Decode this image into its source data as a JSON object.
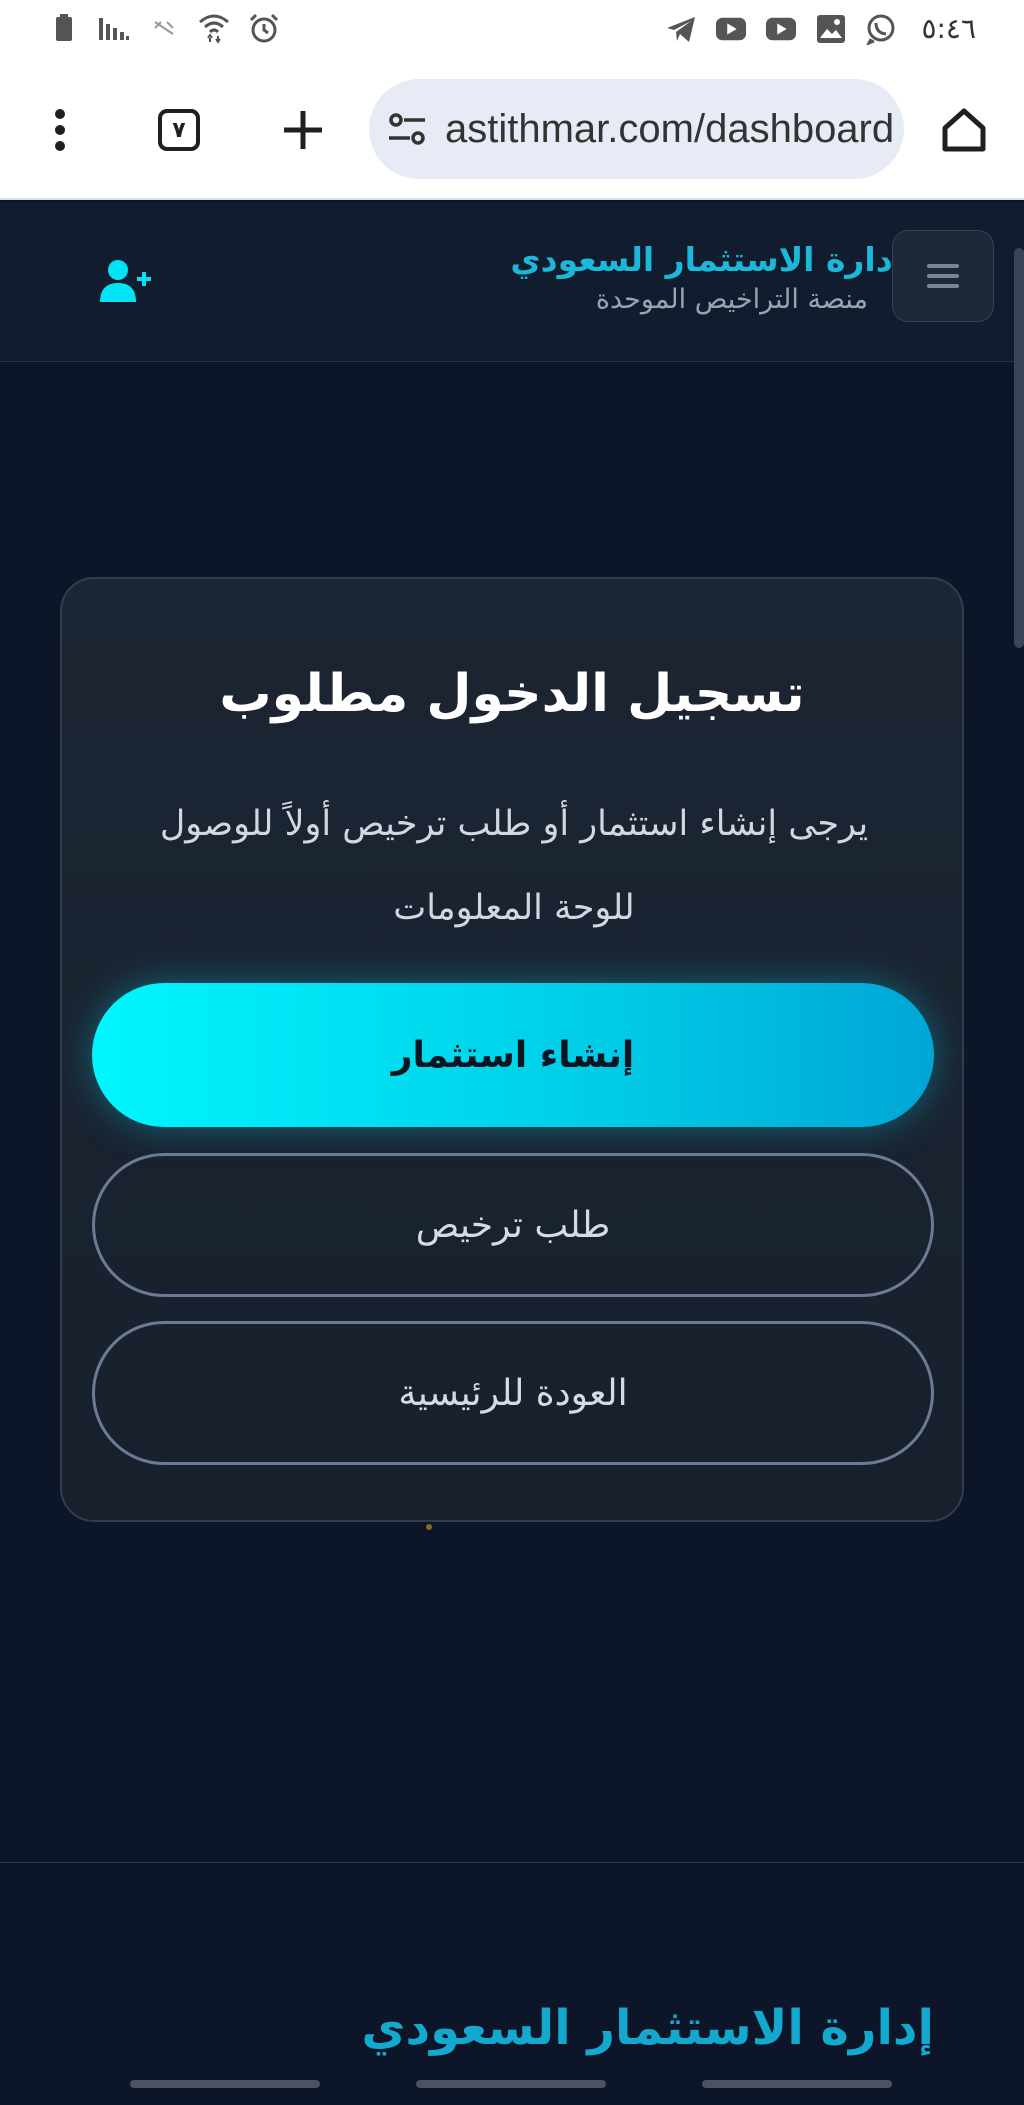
{
  "status_bar": {
    "time": "٥:٤٦",
    "left_icons": [
      "battery-icon",
      "signal-icon",
      "data-off-icon",
      "wifi-icon",
      "alarm-icon"
    ],
    "right_icons": [
      "telegram-icon",
      "youtube-icon",
      "youtube-icon",
      "image-icon",
      "whatsapp-icon"
    ]
  },
  "browser": {
    "url": "astithmar.com/dashboard",
    "tab_count": "٧",
    "icons": [
      "more-vert-icon",
      "tabs-icon",
      "new-tab-icon",
      "site-settings-icon",
      "home-icon"
    ]
  },
  "header": {
    "title": "إدارة الاستثمار السعودي",
    "subtitle": "منصة التراخيص الموحدة",
    "icons": [
      "add-user-icon",
      "menu-icon"
    ]
  },
  "dialog": {
    "title": "تسجيل الدخول مطلوب",
    "description": "يرجى إنشاء استثمار أو طلب ترخيص أولاً للوصول للوحة المعلومات",
    "primary_button": "إنشاء استثمار",
    "license_button": "طلب ترخيص",
    "home_button": "العودة للرئيسية"
  },
  "footer": {
    "title": "إدارة الاستثمار السعودي"
  },
  "colors": {
    "accent": "#1cb8d9",
    "primary_button": "#00f6ff",
    "background": "#0d1628"
  }
}
